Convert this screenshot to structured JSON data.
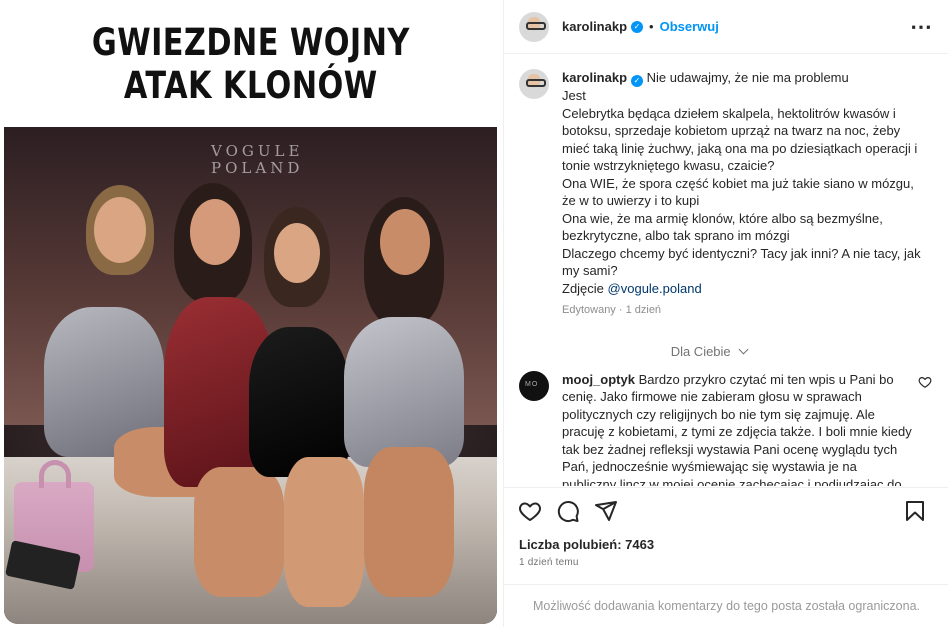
{
  "media": {
    "title_line1": "GWIEZDNE WOJNY",
    "title_line2": "ATAK KLONÓW",
    "watermark_line1": "VOGULE",
    "watermark_line2": "POLAND"
  },
  "header": {
    "username": "karolinakp",
    "separator": "•",
    "follow_label": "Obserwuj",
    "more_icon": "more-horizontal-icon"
  },
  "caption": {
    "username": "karolinakp",
    "lines": [
      "Nie udawajmy, że nie ma problemu",
      "Jest",
      "Celebrytka będąca dziełem skalpela, hektolitrów kwasów i botoksu, sprzedaje kobietom uprząż na twarz na noc, żeby mieć taką linię żuchwy, jaką ona ma po dziesiątkach operacji i tonie wstrzykniętego kwasu, czaicie?",
      "Ona WIE, że spora część kobiet ma już takie siano w mózgu, że w to uwierzy i to kupi",
      "Ona wie, że ma armię klonów, które albo są bezmyślne, bezkrytyczne, albo tak sprano im mózgi",
      "Dlaczego chcemy być identyczni? Tacy jak inni? A nie tacy, jak my sami?"
    ],
    "photo_credit_prefix": "Zdjęcie ",
    "photo_credit_mention": "@vogule.poland",
    "meta": "Edytowany · 1 dzień"
  },
  "for_you": "Dla Ciebie",
  "comment": {
    "username": "mooj_optyk",
    "text": "Bardzo przykro czytać mi ten wpis u Pani bo cenię. Jako firmowe nie zabieram głosu w sprawach politycznych czy religijnych bo nie tym się zajmuję. Ale pracuję z kobietami, z tymi ze zdjęcia także. I boli mnie kiedy tak bez żadnej refleksji wystawia Pani ocenę wyglądu tych Pań, jednocześnie wyśmiewając się wystawia je na publiczny lincz w mojej ocenie zachęcając i podjudzając do HEJTU. Znam Panie osobiście i dla mnie to prostu świetne osoby, kobiety pomocne i o wielkim"
  },
  "actions": {
    "like_icon": "heart-icon",
    "comment_icon": "comment-icon",
    "share_icon": "share-icon",
    "save_icon": "bookmark-icon"
  },
  "likes_label": "Liczba polubień: 7463",
  "time_label": "1 dzień temu",
  "footer": "Możliwość dodawania komentarzy do tego posta została ograniczona.",
  "colors": {
    "accent": "#0095f6",
    "mention": "#00376b",
    "muted": "#737373"
  }
}
